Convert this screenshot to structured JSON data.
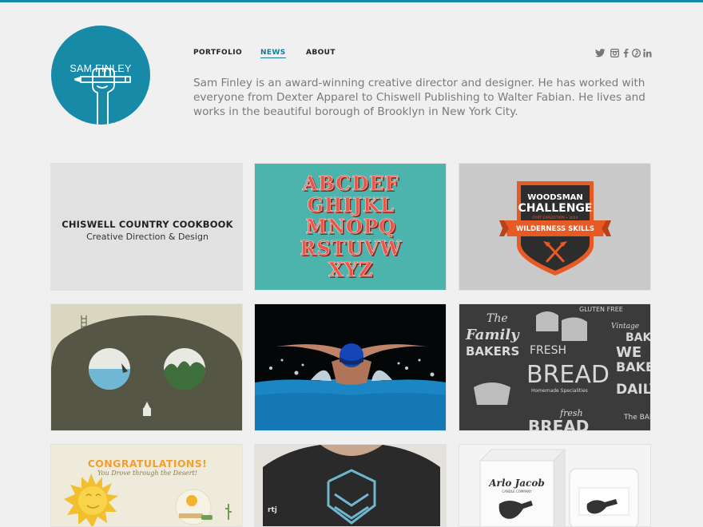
{
  "logo": {
    "text": "SAM FINLEY"
  },
  "nav": [
    {
      "label": "PORTFOLIO"
    },
    {
      "label": "NEWS"
    },
    {
      "label": "ABOUT"
    }
  ],
  "social": [
    "twitter-icon",
    "instagram-icon",
    "facebook-icon",
    "pinterest-icon",
    "linkedin-icon"
  ],
  "bio": "Sam Finley is an award-winning creative director and designer. He has worked with everyone from Dexter Apparel to Chiswell Publishing to Walter Fabian. He lives and works in the beautiful borough of Brooklyn in New York City.",
  "portfolio": {
    "cookbook": {
      "title": "CHISWELL COUNTRY COOKBOOK",
      "subtitle": "Creative Direction & Design"
    },
    "alphabet": {
      "lines": [
        "ABCDEF",
        "GHIJKL",
        "MNOPQ",
        "RSTUVW",
        "XYZ"
      ]
    },
    "woodsman": {
      "line1": "WOODSMAN",
      "line2": "CHALLENGE",
      "small": "FORT EXPEDITION • 2014",
      "ribbon": "WILDERNESS SKILLS"
    },
    "family_bakers": {
      "words": [
        "The",
        "Family",
        "BAKERS",
        "FRESH",
        "BREAD",
        "Homemade Specialities",
        "GLUTEN FREE",
        "Vintage",
        "BAKE",
        "WE",
        "BAKE",
        "DAILY",
        "fresh",
        "BREAD",
        "The BAKE SHO"
      ]
    },
    "congrats": {
      "title": "CONGRATULATIONS!",
      "subtitle": "You Drove through the Desert!"
    },
    "candle": {
      "brand": "Arlo Jacob",
      "tagline": "CANDLE COMPANY"
    }
  }
}
